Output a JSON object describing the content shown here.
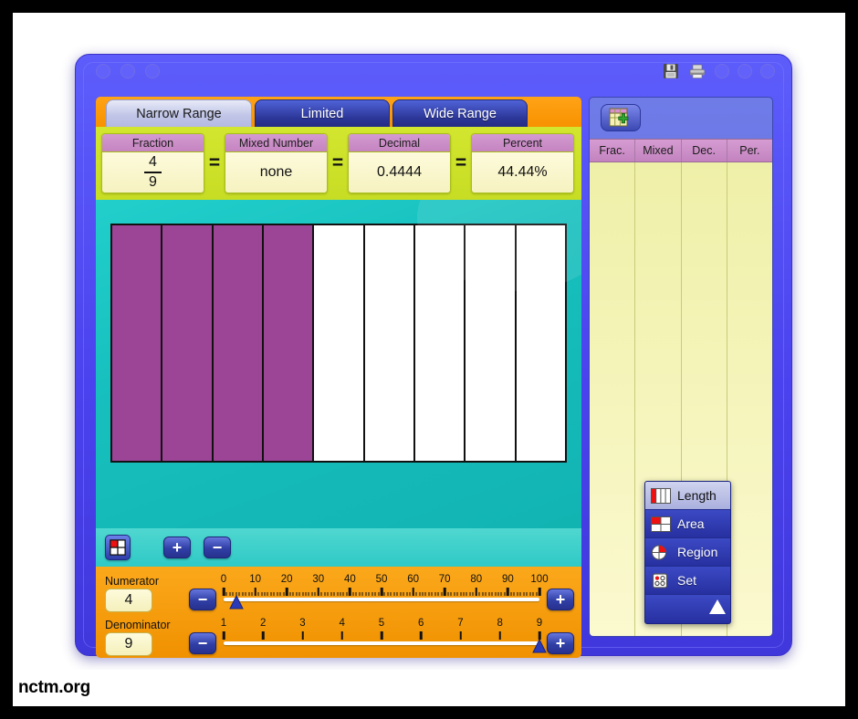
{
  "footer": {
    "label": "nctm.org"
  },
  "titlebar": {
    "circles": 3,
    "save_icon": "floppy-disk-icon",
    "print_icon": "printer-icon",
    "right_circles": 3
  },
  "tabs": [
    {
      "label": "Narrow Range",
      "active": true
    },
    {
      "label": "Limited",
      "active": false
    },
    {
      "label": "Wide Range",
      "active": false
    }
  ],
  "values": {
    "fraction": {
      "header": "Fraction",
      "numerator": "4",
      "denominator": "9"
    },
    "mixed": {
      "header": "Mixed Number",
      "value": "none"
    },
    "decimal": {
      "header": "Decimal",
      "value": "0.4444"
    },
    "percent": {
      "header": "Percent",
      "value": "44.44%"
    },
    "equals": "="
  },
  "model": {
    "type": "length",
    "total_parts": 9,
    "filled_parts": 4,
    "fill_color": "#9c4496",
    "empty_color": "#ffffff"
  },
  "toolbar": {
    "mode_icon": "area-model-icon",
    "add_label": "+",
    "remove_label": "−"
  },
  "sliders": {
    "numerator": {
      "label": "Numerator",
      "value": "4",
      "min": 0,
      "max": 100,
      "tick_labels": [
        "0",
        "10",
        "20",
        "30",
        "40",
        "50",
        "60",
        "70",
        "80",
        "90",
        "100"
      ],
      "minus_label": "−",
      "plus_label": "+"
    },
    "denominator": {
      "label": "Denominator",
      "value": "9",
      "min": 1,
      "max": 9,
      "tick_labels": [
        "1",
        "2",
        "3",
        "4",
        "5",
        "6",
        "7",
        "8",
        "9"
      ],
      "minus_label": "−",
      "plus_label": "+"
    }
  },
  "table": {
    "add_button_icon": "add-to-table-icon",
    "columns": [
      "Frac.",
      "Mixed",
      "Dec.",
      "Per."
    ],
    "rows": []
  },
  "popup_menu": {
    "items": [
      {
        "label": "Length",
        "icon": "length-model-icon",
        "selected": true
      },
      {
        "label": "Area",
        "icon": "area-model-icon",
        "selected": false
      },
      {
        "label": "Region",
        "icon": "region-model-icon",
        "selected": false
      },
      {
        "label": "Set",
        "icon": "set-model-icon",
        "selected": false
      }
    ],
    "collapse_icon": "triangle-up-icon"
  },
  "colors": {
    "frame": "#4a42ee",
    "tabstrip": "#fba81b",
    "valuebar": "#cce028",
    "workarea": "#16bfbd",
    "fill": "#9c4496",
    "table": "#f5f3c2"
  }
}
